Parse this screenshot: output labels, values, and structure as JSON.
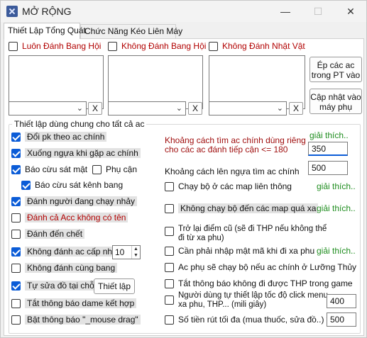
{
  "window": {
    "title": "MỞ RỘNG",
    "min": "—",
    "max": "☐",
    "close": "✕"
  },
  "tabs": [
    {
      "label": "Thiết Lập Tổng Quát"
    },
    {
      "label": "Chức Năng Kéo Liên Máy"
    }
  ],
  "top_checks": [
    {
      "label": "Luôn Đánh Bang Hội",
      "checked": false
    },
    {
      "label": "Không Đánh Bang Hội",
      "checked": false
    },
    {
      "label": "Không Đánh Nhật Vật",
      "checked": false
    }
  ],
  "x_label": "X",
  "buttons": {
    "ep_cac_ac": "Ép các ac trong PT vào",
    "cap_nhat": "Cập nhật vào máy phụ",
    "thiet_lap": "Thiết lập"
  },
  "group": {
    "label": "Thiết lập dùng chung cho tất cả ac"
  },
  "left_options": [
    {
      "label": "Đổi pk theo ac chính",
      "checked": true
    },
    {
      "label": "Xuống ngựa khi gặp ac chính",
      "checked": true
    },
    {
      "label": "Báo cừu sát mật",
      "checked": true
    },
    {
      "label": "Phụ cận",
      "checked": false
    },
    {
      "label": "Báo cừu sát kênh bang",
      "checked": true
    },
    {
      "label": "Đánh người đang chạy nhảy",
      "checked": true
    },
    {
      "label": "Đánh cả Acc không có tên",
      "checked": false
    },
    {
      "label": "Đánh đến chết",
      "checked": false
    },
    {
      "label": "Không đánh ac cấp nhỏ",
      "checked": true
    },
    {
      "label": "Không đánh cùng bang",
      "checked": false
    },
    {
      "label": "Tự sửa đồ tại chỗ",
      "checked": true
    },
    {
      "label": "Tắt thông báo dame kết hợp",
      "checked": false
    },
    {
      "label": "Bật thông báo \"_mouse drag\"",
      "checked": false
    }
  ],
  "level_value": "10",
  "right": {
    "distance_label_1": "Khoảng cách tìm ac chính dùng riêng",
    "distance_label_2": "cho các ac đánh tiếp cận <= 180",
    "distance_value": "350",
    "horse_label": "Khoảng cách lên ngựa tìm ac chính",
    "horse_value": "500",
    "explain": "giải thích..",
    "options": [
      {
        "label": "Chạy bộ ở các map liên thông",
        "checked": false
      },
      {
        "label": "Không chạy bộ đến các map quá xa",
        "checked": false
      },
      {
        "label_1": "Trở lại điểm cũ (sẽ đi THP nếu không thể",
        "label_2": "đi từ xa phu)",
        "checked": false
      },
      {
        "label": "Cần phải nhập mật mã khi đi xa phu",
        "checked": false
      },
      {
        "label": "Ac phụ sẽ chạy bộ nếu ac chính ở Lưỡng Thủy",
        "checked": false
      },
      {
        "label": "Tắt thông báo không đi được THP trong game",
        "checked": false
      },
      {
        "label_1": "Người dùng tự thiết lập tốc độ click menu",
        "label_2": "xa phu, THP... (mili giây)",
        "checked": false
      },
      {
        "label": "Số tiền rút tối đa (mua thuốc, sửa đồ..) vạn",
        "checked": false
      }
    ],
    "click_speed_value": "400",
    "max_money_value": "500"
  }
}
